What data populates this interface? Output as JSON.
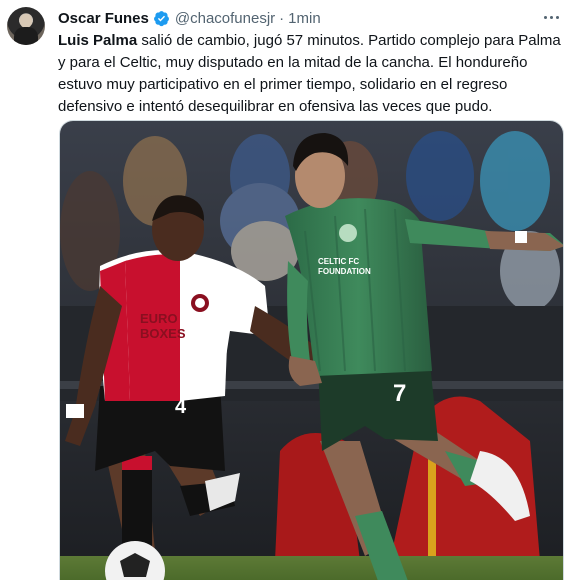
{
  "tweet": {
    "author_name": "Oscar Funes",
    "handle": "@chacofunesjr",
    "separator": "·",
    "time": "1min",
    "text_bold": "Luis Palma",
    "text_rest": " salió de cambio, jugó 57 minutos. Partido complejo para Palma y para el Celtic, muy disputado en la mitad de la cancha. El hondureño estuvo muy participativo en el primer tiempo, solidario en el regreso defensivo e intentó desequilibrar en ofensiva las veces que pudo."
  },
  "media": {
    "left_shirt_sponsor_line1": "EURO",
    "left_shirt_sponsor_line2": "BOXES",
    "left_shorts_number": "4",
    "right_shirt_sponsor_line1": "CELTIC FC",
    "right_shirt_sponsor_line2": "FOUNDATION",
    "right_shorts_number": "7"
  },
  "colors": {
    "verified_blue": "#1d9bf0",
    "muted_text": "#536471",
    "celtic_green": "#2e7a4f",
    "feyenoord_red": "#c8102e"
  }
}
